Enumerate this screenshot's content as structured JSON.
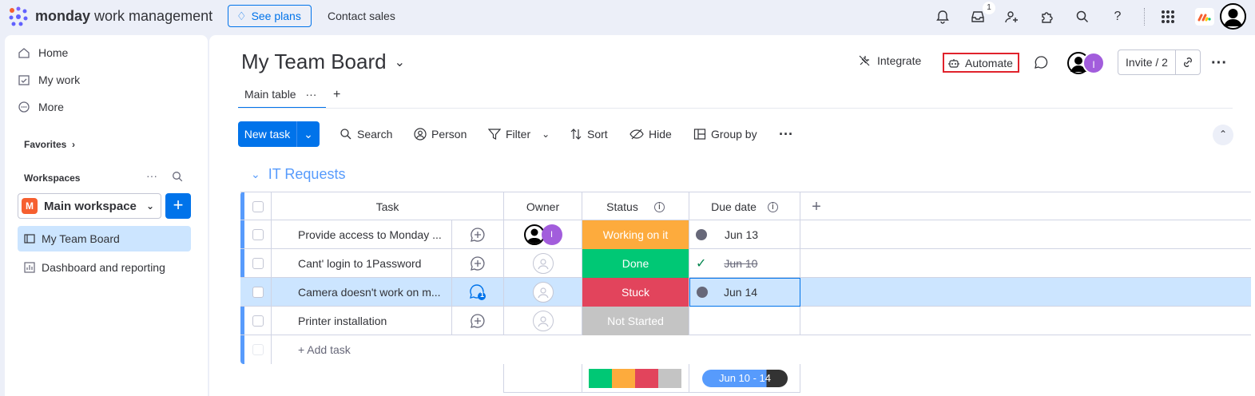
{
  "topbar": {
    "brand_bold": "monday",
    "brand_light": "work management",
    "see_plans": "See plans",
    "contact_sales": "Contact sales",
    "inbox_badge": "1",
    "icons": [
      "bell-icon",
      "inbox-icon",
      "invite-member-icon",
      "apps-icon",
      "search-icon",
      "help-icon",
      "grid-icon",
      "monday-logo",
      "user-avatar"
    ]
  },
  "sidebar": {
    "nav": [
      {
        "label": "Home",
        "icon": "home-icon"
      },
      {
        "label": "My work",
        "icon": "calendar-check-icon"
      },
      {
        "label": "More",
        "icon": "more-circle-icon"
      }
    ],
    "favorites": "Favorites",
    "workspaces": "Workspaces",
    "workspace_initial": "M",
    "workspace_name": "Main workspace",
    "boards": [
      {
        "label": "My Team Board",
        "icon": "board-icon",
        "selected": true
      },
      {
        "label": "Dashboard and reporting",
        "icon": "dashboard-icon",
        "selected": false
      }
    ]
  },
  "board": {
    "title": "My Team Board",
    "integrate": "Integrate",
    "automate": "Automate",
    "invite": "Invite / 2",
    "member_initial": "I",
    "tab_main": "Main table",
    "toolbar": {
      "new_task": "New task",
      "search": "Search",
      "person": "Person",
      "filter": "Filter",
      "sort": "Sort",
      "hide": "Hide",
      "group_by": "Group by"
    },
    "group": {
      "title": "IT Requests",
      "color": "#579bfc",
      "columns": {
        "task": "Task",
        "owner": "Owner",
        "status": "Status",
        "due": "Due date"
      },
      "rows": [
        {
          "task": "Provide access to Monday ...",
          "owner": "assigned",
          "status": "Working on it",
          "status_color": "#fdab3d",
          "due": "Jun 13",
          "due_icon": "clock-dot",
          "comments": ""
        },
        {
          "task": "Cant' login to 1Password",
          "owner": "empty",
          "status": "Done",
          "status_color": "#00c875",
          "due": "Jun 10",
          "due_icon": "check",
          "comments": ""
        },
        {
          "task": "Camera doesn't work on m...",
          "owner": "empty",
          "status": "Stuck",
          "status_color": "#e2445c",
          "due": "Jun 14",
          "due_icon": "clock-dot",
          "comments": "1"
        },
        {
          "task": "Printer installation",
          "owner": "empty",
          "status": "Not Started",
          "status_color": "#c4c4c4",
          "due": "",
          "due_icon": "",
          "comments": ""
        }
      ],
      "add_task": "+ Add task",
      "summary_range": "Jun 10 - 14"
    }
  },
  "colors": {
    "accent": "#0073ea",
    "selected_row": "#cce5ff",
    "highlight_border": "#e0222c"
  }
}
